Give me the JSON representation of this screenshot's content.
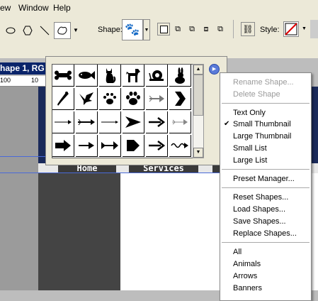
{
  "menubar": {
    "items": [
      {
        "label": "ew"
      },
      {
        "label": "Window"
      },
      {
        "label": "Help"
      }
    ]
  },
  "options": {
    "shape_label": "Shape:",
    "style_label": "Style:"
  },
  "document": {
    "title": "hape 1, RG",
    "ruler": [
      "100",
      "10"
    ]
  },
  "nav": {
    "home": "Home",
    "services": "Services"
  },
  "shape_grid": {
    "rows": [
      [
        "bone-icon",
        "fish-icon",
        "cat-icon",
        "dog-icon",
        "snail-icon",
        "rabbit-icon"
      ],
      [
        "bird-icon",
        "dove-icon",
        "paw-print-icon",
        "paw-print-icon",
        "arrow-icon",
        "arrow-icon"
      ],
      [
        "arrow-icon",
        "arrow-icon",
        "arrow-icon",
        "arrow-icon",
        "arrow-icon",
        "arrow-icon"
      ],
      [
        "arrow-icon",
        "arrow-icon",
        "arrow-icon",
        "arrow-icon",
        "arrow-icon",
        "arrow-icon"
      ]
    ]
  },
  "menu": {
    "items": [
      {
        "label": "Rename Shape..."
      },
      {
        "label": "Delete Shape"
      },
      {
        "label": "Text Only"
      },
      {
        "label": "Small Thumbnail"
      },
      {
        "label": "Large Thumbnail"
      },
      {
        "label": "Small List"
      },
      {
        "label": "Large List"
      },
      {
        "label": "Preset Manager..."
      },
      {
        "label": "Reset Shapes..."
      },
      {
        "label": "Load Shapes..."
      },
      {
        "label": "Save Shapes..."
      },
      {
        "label": "Replace Shapes..."
      },
      {
        "label": "All"
      },
      {
        "label": "Animals"
      },
      {
        "label": "Arrows"
      },
      {
        "label": "Banners"
      }
    ]
  }
}
